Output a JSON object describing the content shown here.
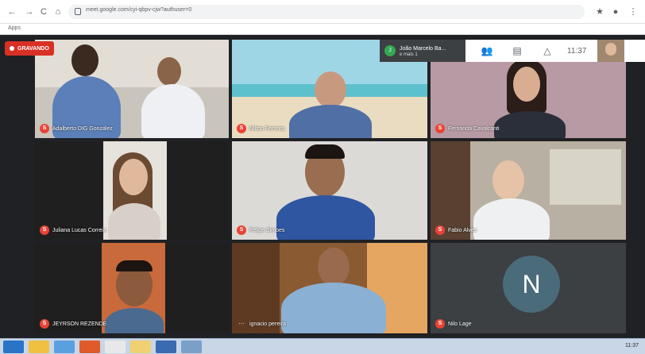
{
  "browser": {
    "back": "←",
    "forward": "→",
    "reload": "C",
    "home": "⌂",
    "url": "meet.google.com/cyi-qbpv-cjw?authuser=0",
    "bookmark": "Apps"
  },
  "meeting": {
    "recording_label": "GRAVANDO",
    "presenter_initial": "J",
    "presenter_name": "João Marcelo Ba...",
    "presenter_sub": "e mais 1",
    "time": "11:37",
    "participants_icon": "people-icon",
    "chat_icon": "chat-icon",
    "activities_icon": "shapes-icon"
  },
  "tiles": [
    {
      "name": "Adalberto DIG González",
      "mic": "muted"
    },
    {
      "name": "Nilton Ferreira",
      "mic": "muted"
    },
    {
      "name": "Fernanda Cavalcanti",
      "mic": "muted"
    },
    {
      "name": "Juliana Lucas Correia",
      "mic": "muted"
    },
    {
      "name": "Felipe Simoes",
      "mic": "muted"
    },
    {
      "name": "Fabio Alves",
      "mic": "muted"
    },
    {
      "name": "JEYRSON REZENDE",
      "mic": "muted"
    },
    {
      "name": "ignacio pereira",
      "mic": "active"
    },
    {
      "name": "Nilo Lage",
      "mic": "muted",
      "avatar_letter": "N"
    }
  ],
  "taskbar": {
    "tray": "11:37"
  }
}
